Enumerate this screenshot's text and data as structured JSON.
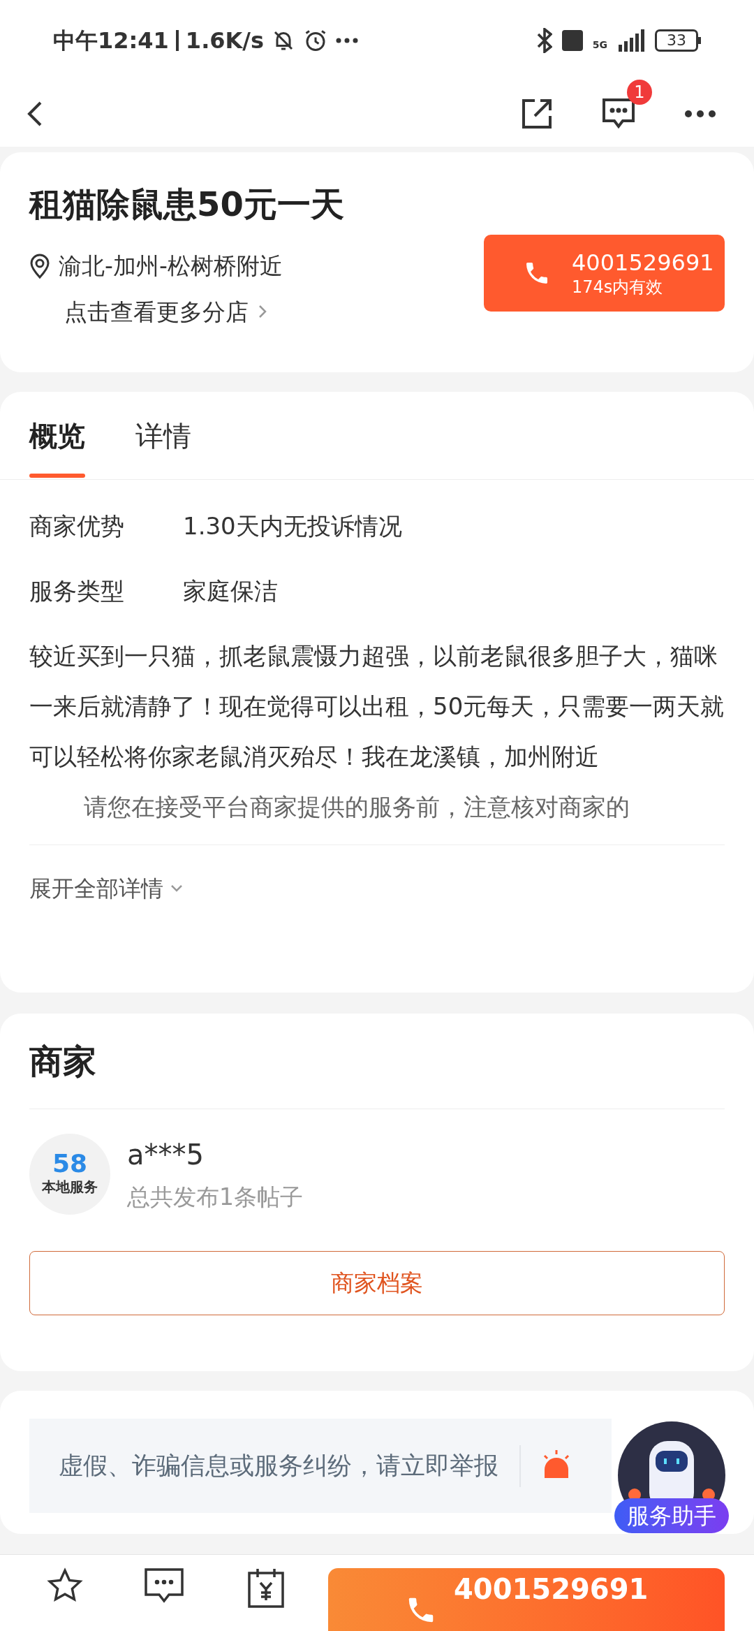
{
  "status_bar": {
    "time": "中午12:41",
    "speed": "1.6K/s",
    "network": "5G",
    "battery": "33"
  },
  "nav": {
    "message_badge": "1"
  },
  "header": {
    "title": "租猫除鼠患50元一天",
    "location": "渝北-加州-松树桥附近",
    "branches_link": "点击查看更多分店",
    "call_button": {
      "number": "4001529691",
      "validity": "174s内有效"
    }
  },
  "detail_tabs": [
    {
      "label": "概览",
      "selected": true
    },
    {
      "label": "详情",
      "selected": false
    }
  ],
  "overview": {
    "fields": [
      {
        "label": "商家优势",
        "value": "1.30天内无投诉情况"
      },
      {
        "label": "服务类型",
        "value": "家庭保洁"
      }
    ],
    "description": "较近买到一只猫，抓老鼠震慑力超强，以前老鼠很多胆子大，猫咪一来后就清静了！现在觉得可以出租，50元每天，只需要一两天就可以轻松将你家老鼠消灭殆尽！我在龙溪镇，加州附近",
    "notice": "请您在接受平台商家提供的服务前，注意核对商家的",
    "expand_link": "展开全部详情"
  },
  "merchant": {
    "heading": "商家",
    "avatar_number": "58",
    "avatar_label": "本地服务",
    "name": "a***5",
    "post_count": "总共发布1条帖子",
    "profile_button": "商家档案"
  },
  "report_bar": {
    "text": "虚假、诈骗信息或服务纠纷，请立即举报"
  },
  "assistant": {
    "label": "服务助手"
  },
  "bottom_bar": {
    "call_number": "4001529691"
  }
}
